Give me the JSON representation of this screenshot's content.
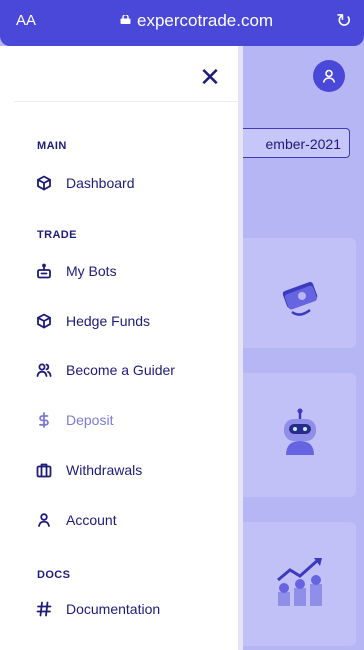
{
  "browser": {
    "aa_label": "AA",
    "host": "expercotrade.com",
    "reload_glyph": "↻"
  },
  "background": {
    "date_text": "ember-2021"
  },
  "drawer": {
    "close_glyph": "✕",
    "sections": {
      "main": "MAIN",
      "trade": "TRADE",
      "docs": "DOCS"
    },
    "items": {
      "dashboard": "Dashboard",
      "my_bots": "My Bots",
      "hedge_funds": "Hedge Funds",
      "become_guider": "Become a Guider",
      "deposit": "Deposit",
      "withdrawals": "Withdrawals",
      "account": "Account",
      "documentation": "Documentation"
    }
  },
  "colors": {
    "accent": "#4a48d8",
    "text": "#1e1b7a",
    "muted": "#7b7ad6",
    "overlay": "#b7b6f5"
  }
}
